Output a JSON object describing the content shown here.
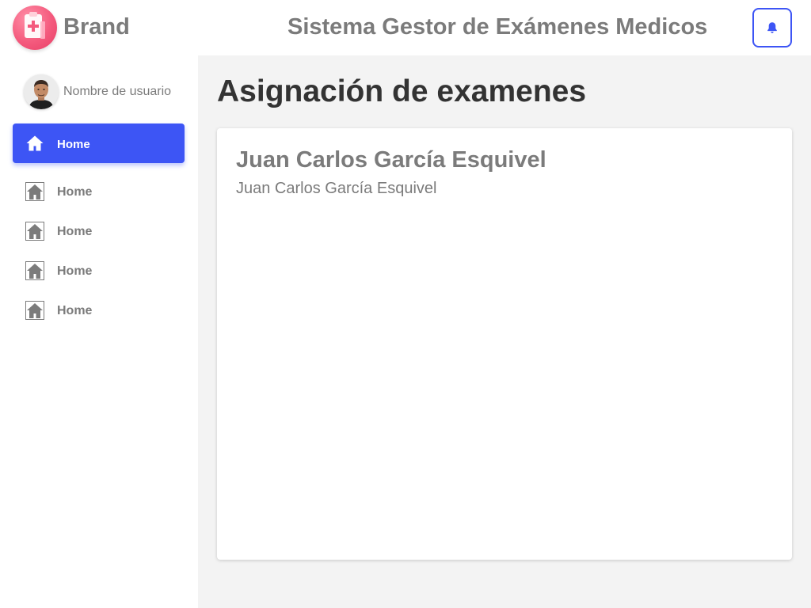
{
  "header": {
    "brand_name": "Brand",
    "app_title": "Sistema Gestor de Exámenes Medicos",
    "brand_logo_icon": "clipboard-medical-icon",
    "notifications_icon": "bell-icon"
  },
  "sidebar": {
    "user_name": "Nombre de usuario",
    "items": [
      {
        "label": "Home",
        "icon": "home-icon",
        "active": true
      },
      {
        "label": "Home",
        "icon": "home-icon",
        "active": false
      },
      {
        "label": "Home",
        "icon": "home-icon",
        "active": false
      },
      {
        "label": "Home",
        "icon": "home-icon",
        "active": false
      },
      {
        "label": "Home",
        "icon": "home-icon",
        "active": false
      }
    ]
  },
  "main": {
    "page_title": "Asignación de examenes",
    "card": {
      "title": "Juan Carlos García Esquivel",
      "subtitle": "Juan Carlos García Esquivel"
    }
  },
  "colors": {
    "accent": "#3d55f5",
    "text_muted": "#7b7b7b",
    "text_dark": "#333333",
    "background": "#f3f3f3",
    "logo": "#f45a7d"
  }
}
